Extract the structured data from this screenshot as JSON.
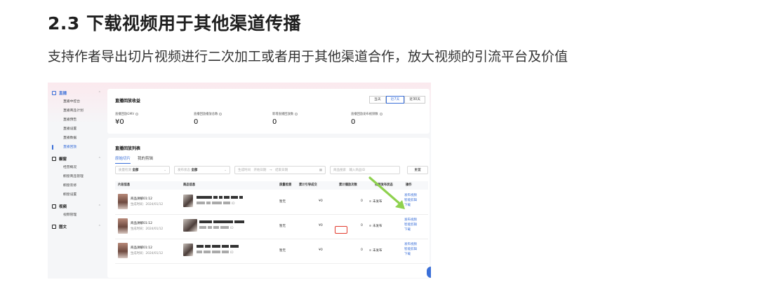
{
  "doc": {
    "title": "2.3 下载视频用于其他渠道传播",
    "description": "支持作者导出切片视频进行二次加工或者用于其他渠道合作，放大视频的引流平台及价值"
  },
  "colors": {
    "accent": "#3a6fd8",
    "highlight": "#e23b2e",
    "arrow": "#8fd14f"
  },
  "sidebar": {
    "groups": [
      {
        "label": "直播",
        "icon": "live-icon",
        "active": true,
        "items": [
          "直播中控台",
          "直播商品计划",
          "直播预告",
          "直播设置",
          "直播数据",
          "直播回放"
        ]
      },
      {
        "label": "橱窗",
        "icon": "shop-icon",
        "active": false,
        "items": [
          "经营概况",
          "橱窗商品管理",
          "橱窗装修",
          "橱窗设置"
        ]
      },
      {
        "label": "视频",
        "icon": "video-icon",
        "active": false,
        "items": [
          "视频管理"
        ]
      },
      {
        "label": "图文",
        "icon": "post-icon",
        "active": false,
        "items": []
      }
    ],
    "active_item": "直播回放"
  },
  "revenue": {
    "title": "直播回放收益",
    "periods": [
      "当天",
      "近7天",
      "近30天"
    ],
    "active_period": "近7天",
    "metrics": [
      {
        "label": "直播回放GMV",
        "value": "¥0"
      },
      {
        "label": "直播回放播放总数",
        "value": "0"
      },
      {
        "label": "新增直播回放数",
        "value": "0"
      },
      {
        "label": "直播回放发布视频数",
        "value": "0"
      }
    ]
  },
  "list": {
    "title": "直播回放列表",
    "tabs": [
      "原始切片",
      "我的剪辑"
    ],
    "active_tab": "原始切片",
    "filters": {
      "source": {
        "label": "质量检测",
        "value": "全部"
      },
      "publish": {
        "label": "发布状态",
        "value": "全部"
      },
      "time": {
        "label": "生成时间",
        "start": "开始日期",
        "end": "结束日期"
      },
      "product": {
        "label": "商品搜索",
        "placeholder": "输入商品ID"
      },
      "reset_label": "重置"
    },
    "columns": [
      "片段信息",
      "商品信息",
      "质量检测",
      "累计引导成交",
      "累计播放次数",
      "视频发布状态",
      "操作"
    ],
    "rows": [
      {
        "clip_name": "商品讲解01:12",
        "clip_time": "生成时间：2024/01/12",
        "product_sub": "ID",
        "quality": "暂无",
        "gmv": "¥0",
        "plays": "0",
        "status": "未发布",
        "ops": [
          "发布视频",
          "智能剪辑",
          "下载"
        ]
      },
      {
        "clip_name": "商品讲解01:12",
        "clip_time": "生成时间：2024/01/12",
        "product_sub": "ID",
        "quality": "暂无",
        "gmv": "¥0",
        "plays": "0",
        "status": "未发布",
        "ops": [
          "发布视频",
          "智能剪辑",
          "下载"
        ]
      },
      {
        "clip_name": "商品讲解01:12",
        "clip_time": "生成时间：2024/01/12",
        "product_sub": "ID",
        "quality": "暂无",
        "gmv": "¥0",
        "plays": "0",
        "status": "未发布",
        "ops": [
          "发布视频",
          "智能剪辑",
          "下载"
        ]
      }
    ]
  }
}
